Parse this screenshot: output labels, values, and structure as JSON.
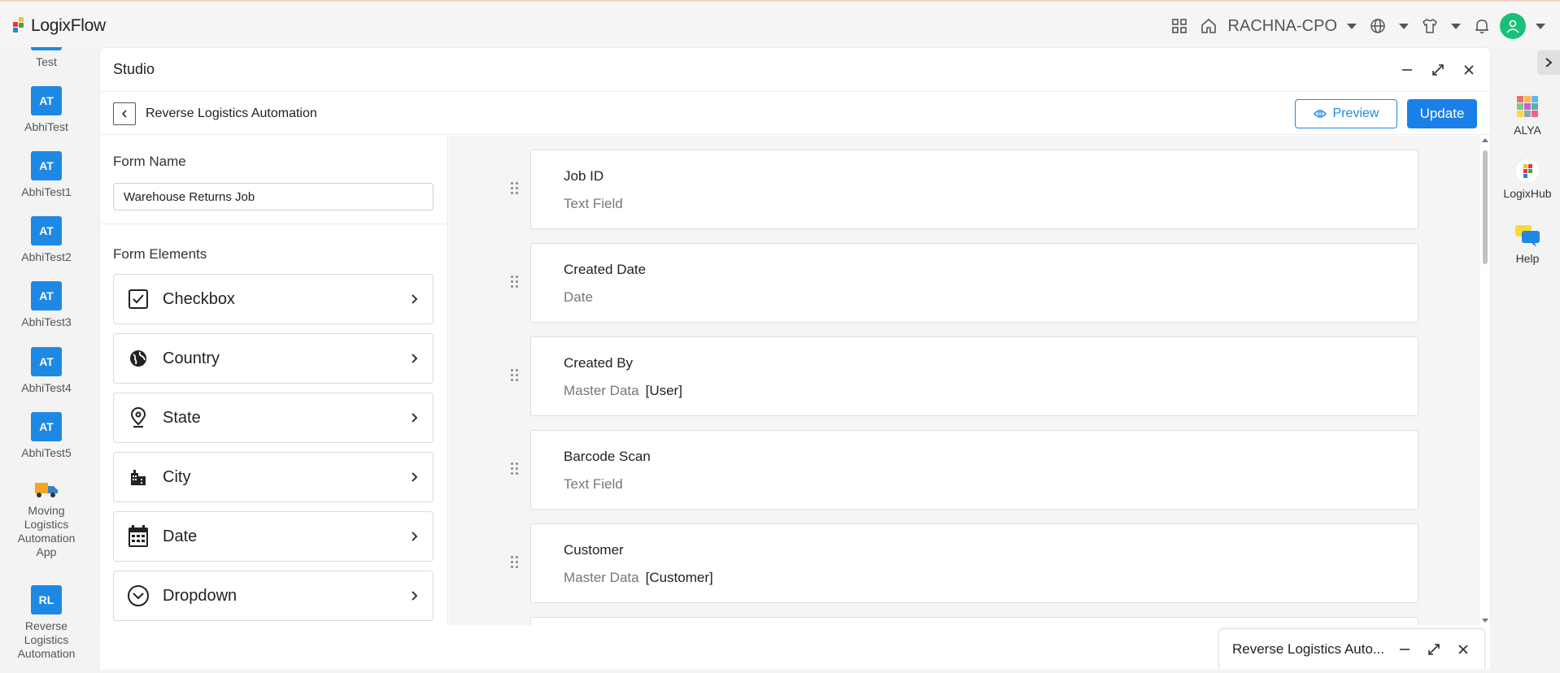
{
  "brand": {
    "name": "LogixFlow"
  },
  "topbar": {
    "tenant": "RACHNA-CPO"
  },
  "left_rail": {
    "items": [
      {
        "badge": "",
        "label": "Test"
      },
      {
        "badge": "AT",
        "label": "AbhiTest"
      },
      {
        "badge": "AT",
        "label": "AbhiTest1"
      },
      {
        "badge": "AT",
        "label": "AbhiTest2"
      },
      {
        "badge": "AT",
        "label": "AbhiTest3"
      },
      {
        "badge": "AT",
        "label": "AbhiTest4"
      },
      {
        "badge": "AT",
        "label": "AbhiTest5"
      },
      {
        "badge": "",
        "label_lines": [
          "Moving",
          "Logistics",
          "Automation",
          "App"
        ]
      },
      {
        "badge": "RL",
        "label_lines": [
          "Reverse",
          "Logistics",
          "Automation"
        ]
      }
    ]
  },
  "right_rail": {
    "items": [
      {
        "label": "ALYA"
      },
      {
        "label": "LogixHub"
      },
      {
        "label": "Help"
      }
    ]
  },
  "studio": {
    "title": "Studio",
    "app_name": "Reverse Logistics Automation",
    "preview_label": "Preview",
    "update_label": "Update"
  },
  "form_panel": {
    "form_name_label": "Form Name",
    "form_name_value": "Warehouse Returns Job",
    "elements_label": "Form Elements",
    "elements": [
      {
        "label": "Checkbox",
        "icon": "checkbox-icon"
      },
      {
        "label": "Country",
        "icon": "globe-icon"
      },
      {
        "label": "State",
        "icon": "location-pin-icon"
      },
      {
        "label": "City",
        "icon": "city-icon"
      },
      {
        "label": "Date",
        "icon": "calendar-icon"
      },
      {
        "label": "Dropdown",
        "icon": "dropdown-circle-icon"
      }
    ]
  },
  "canvas": {
    "fields": [
      {
        "title": "Job ID",
        "type": "Text Field",
        "ref": ""
      },
      {
        "title": "Created Date",
        "type": "Date",
        "ref": ""
      },
      {
        "title": "Created By",
        "type": "Master Data",
        "ref": "[User]"
      },
      {
        "title": "Barcode Scan",
        "type": "Text Field",
        "ref": ""
      },
      {
        "title": "Customer",
        "type": "Master Data",
        "ref": "[Customer]"
      }
    ]
  },
  "minimized_tab": {
    "title": "Reverse Logistics Auto..."
  },
  "colors": {
    "accent": "#1a7fe6",
    "avatar": "#19c07a"
  }
}
